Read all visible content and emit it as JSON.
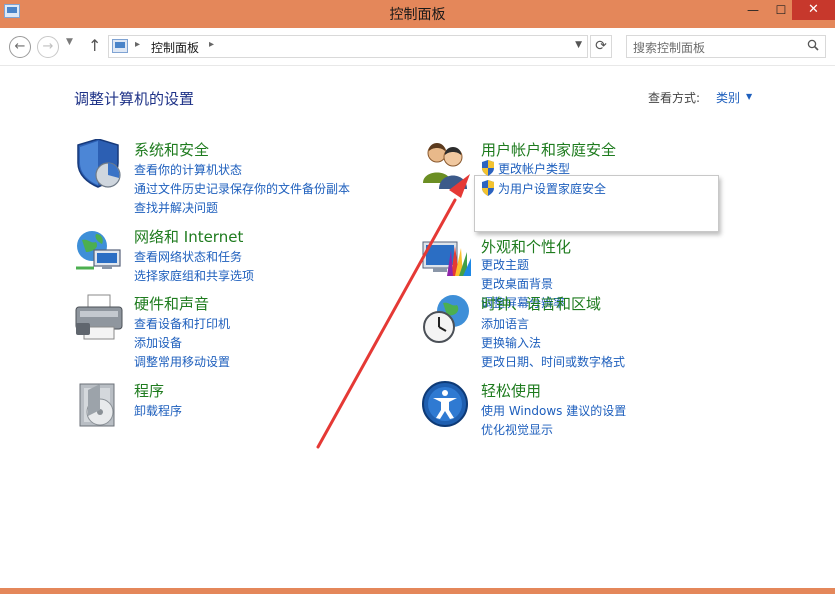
{
  "window": {
    "title": "控制面板"
  },
  "nav": {
    "address": "控制面板",
    "search_placeholder": "搜索控制面板"
  },
  "main": {
    "heading": "调整计算机的设置",
    "view_by_label": "查看方式:",
    "view_by_value": "类别"
  },
  "categories": [
    {
      "title": "系统和安全",
      "icon": "shield-icon",
      "links": [
        "查看你的计算机状态",
        "通过文件历史记录保存你的文件备份副本",
        "查找并解决问题"
      ]
    },
    {
      "title": "网络和 Internet",
      "icon": "network-icon",
      "links": [
        "查看网络状态和任务",
        "选择家庭组和共享选项"
      ]
    },
    {
      "title": "硬件和声音",
      "icon": "printer-icon",
      "links": [
        "查看设备和打印机",
        "添加设备",
        "调整常用移动设置"
      ]
    },
    {
      "title": "程序",
      "icon": "programs-icon",
      "links": [
        "卸载程序"
      ]
    },
    {
      "title": "用户帐户和家庭安全",
      "icon": "users-icon",
      "links": [
        "更改帐户类型",
        "为用户设置家庭安全"
      ]
    },
    {
      "title": "外观和个性化",
      "icon": "appearance-icon",
      "links": [
        "更改主题",
        "更改桌面背景",
        "调整屏幕分辨率"
      ]
    },
    {
      "title": "时钟、语言和区域",
      "icon": "clock-globe-icon",
      "links": [
        "添加语言",
        "更换输入法",
        "更改日期、时间或数字格式"
      ]
    },
    {
      "title": "轻松使用",
      "icon": "ease-of-access-icon",
      "links": [
        "使用 Windows 建议的设置",
        "优化视觉显示"
      ]
    }
  ],
  "colors": {
    "accent": "#e4875a",
    "link": "#1e5fbd",
    "category_title": "#1e7b1e",
    "annotation_arrow": "#e53935"
  }
}
